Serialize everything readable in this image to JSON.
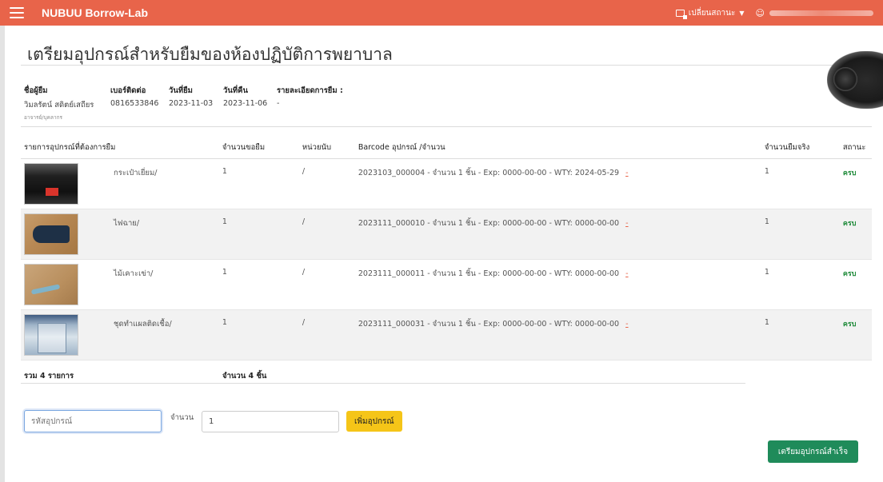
{
  "header": {
    "brand": "NUBUU Borrow-Lab",
    "status_switch_label": "เปลี่ยนสถานะ",
    "menu_icon": "hamburger-icon",
    "status_icon": "switch-icon",
    "user_icon": "user-icon"
  },
  "page": {
    "title": "เตรียมอุปกรณ์สำหรับยืมของห้องปฏิบัติการพยาบาล"
  },
  "borrow_info": {
    "borrower_label": "ชื่อผู้ยืม",
    "borrower_name": "วิมลรัตน์ สดิตย์เสถียร",
    "borrower_role": "อาจารย์/บุคลากร",
    "phone_label": "เบอร์ติดต่อ",
    "phone": "0816533846",
    "borrow_date_label": "วันที่ยืม",
    "borrow_date": "2023-11-03",
    "return_date_label": "วันที่คืน",
    "return_date": "2023-11-06",
    "details_label": "รายละเอียดการยืม :",
    "details": "-"
  },
  "table": {
    "headers": {
      "item": "รายการอุปกรณ์ที่ต้องการยืม",
      "requested_qty": "จำนวนขอยืม",
      "unit": "หน่วยนับ",
      "barcode": "Barcode อุปกรณ์ /จำนวน",
      "actual_qty": "จำนวนยืมจริง",
      "status": "สถานะ"
    },
    "rows": [
      {
        "name": "กระเป๋าเยี่ยม/",
        "requested_qty": "1",
        "unit": "/",
        "barcode": "2023103_000004 - จำนวน 1 ชิ้น - Exp: 0000-00-00 - WTY: 2024-05-29",
        "remove": "-",
        "actual_qty": "1",
        "status": "ครบ",
        "image_icon": "bag-photo"
      },
      {
        "name": "ไฟฉาย/",
        "requested_qty": "1",
        "unit": "/",
        "barcode": "2023111_000010 - จำนวน 1 ชิ้น - Exp: 0000-00-00 - WTY: 0000-00-00",
        "remove": "-",
        "actual_qty": "1",
        "status": "ครบ",
        "image_icon": "flashlight-photo"
      },
      {
        "name": "ไม้เคาะเข่า/",
        "requested_qty": "1",
        "unit": "/",
        "barcode": "2023111_000011 - จำนวน 1 ชิ้น - Exp: 0000-00-00 - WTY: 0000-00-00",
        "remove": "-",
        "actual_qty": "1",
        "status": "ครบ",
        "image_icon": "reflex-hammer-photo"
      },
      {
        "name": "ชุดทำแผลติดเชื้อ/",
        "requested_qty": "1",
        "unit": "/",
        "barcode": "2023111_000031 - จำนวน 1 ชิ้น - Exp: 0000-00-00 - WTY: 0000-00-00",
        "remove": "-",
        "actual_qty": "1",
        "status": "ครบ",
        "image_icon": "dressing-set-photo"
      }
    ],
    "summary": {
      "total_items": "รวม 4 รายการ",
      "total_qty": "จำนวน 4 ชิ้น"
    }
  },
  "add_form": {
    "code_placeholder": "รหัสอุปกรณ์",
    "qty_label": "จำนวน",
    "qty_value": "1",
    "add_button": "เพิ่มอุปกรณ์"
  },
  "actions": {
    "done_button": "เตรียมอุปกรณ์สำเร็จ"
  },
  "colors": {
    "header_bg": "#e8644a",
    "status_ok": "#1f8b3a",
    "add_button": "#f5c518",
    "done_button": "#1f8b5a"
  }
}
